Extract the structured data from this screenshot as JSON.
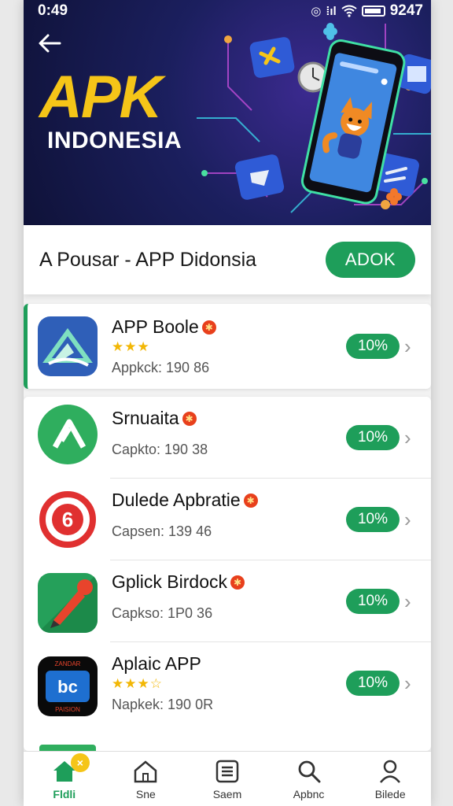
{
  "status": {
    "time": "0:49",
    "battery_text": "9247"
  },
  "hero": {
    "title": "APK",
    "subtitle": "INDONESIA"
  },
  "header": {
    "title": "A Pousar - APP Didonsia",
    "add_label": "ADOK"
  },
  "apps": [
    {
      "name": "APP Boole",
      "rating_stars": "★★★",
      "meta": "Appkck: 190 86",
      "percent": "10%"
    },
    {
      "name": "Srnuaita",
      "meta": "Capkto: 190 38",
      "percent": "10%"
    },
    {
      "name": "Dulede Apbratie",
      "meta": "Capsen: 139 46",
      "percent": "10%"
    },
    {
      "name": "Gplick Birdock",
      "meta": "Capkso: 1P0 36",
      "percent": "10%"
    },
    {
      "name": "Aplaic APP",
      "rating_stars": "★★★☆",
      "meta": "Napkek: 190 0R",
      "percent": "10%"
    }
  ],
  "icon_texts": {
    "aplaic_top": "ZANDAR",
    "aplaic_main": "bc",
    "aplaic_sub": "PAISION"
  },
  "nav": [
    {
      "label": "Fldli",
      "icon": "home-icon",
      "active": true
    },
    {
      "label": "Sne",
      "icon": "house-outline-icon"
    },
    {
      "label": "Saem",
      "icon": "list-icon"
    },
    {
      "label": "Apbnc",
      "icon": "search-icon"
    },
    {
      "label": "Bilede",
      "icon": "profile-icon"
    }
  ],
  "colors": {
    "accent": "#1e9e5a",
    "hero_yellow": "#f5c518",
    "hero_bg": "#1b1f5e"
  }
}
